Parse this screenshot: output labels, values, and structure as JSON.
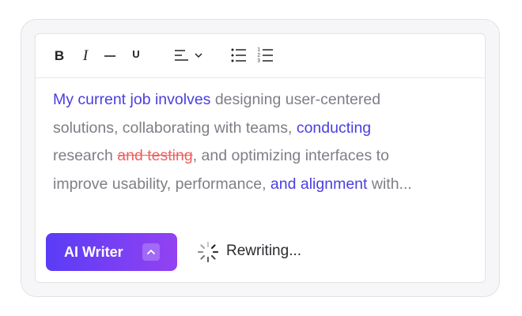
{
  "toolbar": {
    "bold_label": "B",
    "italic_label": "I",
    "underline_label": "U",
    "number_list_digits": [
      "1",
      "2",
      "3"
    ],
    "icons": [
      "bold-icon",
      "italic-icon",
      "strikethrough-icon",
      "underline-icon",
      "align-left-icon",
      "chevron-down-icon",
      "bulleted-list-icon",
      "numbered-list-icon"
    ]
  },
  "content": {
    "line1": {
      "hl": "My current job involves",
      "rest": " designing user-centered"
    },
    "line2": {
      "pre": "solutions, collaborating with teams, ",
      "hl": "conducting"
    },
    "line3": {
      "pre": "research ",
      "deleted": "and testing",
      "post": ", and optimizing interfaces to"
    },
    "line4": {
      "pre": "improve usability, performance, ",
      "hl": "and alignment",
      "post": " with..."
    }
  },
  "ai_writer": {
    "label": "AI Writer",
    "icon": "chevron-up-icon"
  },
  "status": {
    "text": "Rewriting...",
    "icon": "spinner-icon"
  },
  "colors": {
    "accent_start": "#5a3cf6",
    "accent_end": "#9342f2",
    "highlight_text": "#4a3fe0",
    "deleted_text": "#ef5f5f",
    "body_text": "#7e7e86"
  }
}
